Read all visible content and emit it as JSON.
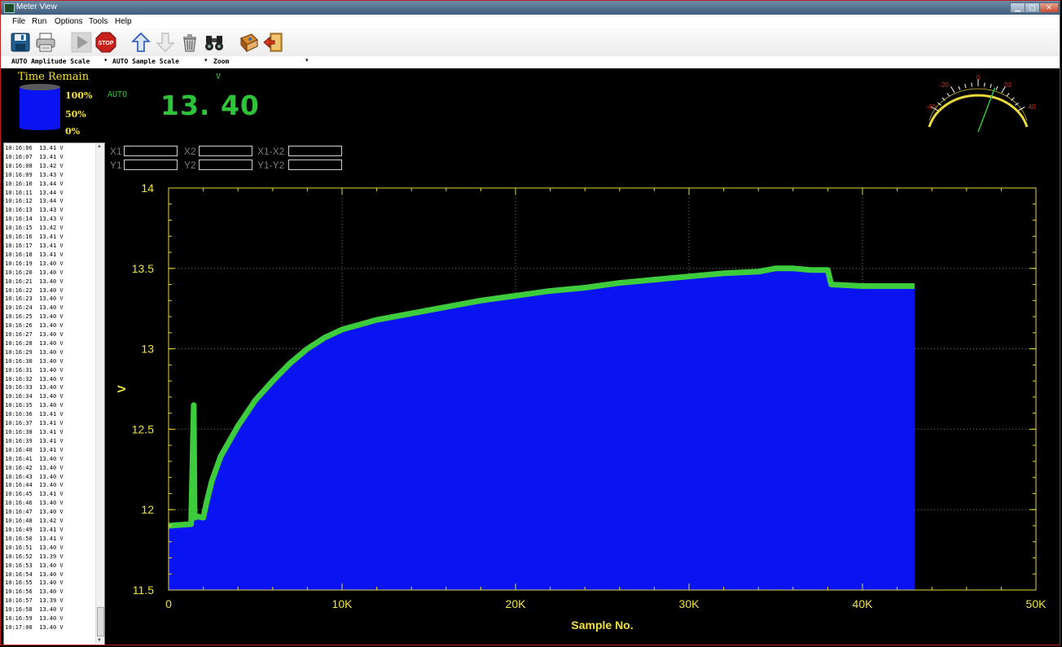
{
  "window": {
    "title": "Meter View",
    "min_glyph": "▁",
    "max_glyph": "▢",
    "close_glyph": "✕"
  },
  "menu": [
    "File",
    "Run",
    "Options",
    "Tools",
    "Help"
  ],
  "toolbar": {
    "buttons": [
      {
        "icon": "save-icon"
      },
      {
        "icon": "print-icon"
      },
      {
        "icon": "play-icon"
      },
      {
        "icon": "stop-icon",
        "label": "STOP"
      },
      {
        "icon": "arrow-up-icon"
      },
      {
        "icon": "arrow-down-icon"
      },
      {
        "icon": "trash-icon"
      },
      {
        "icon": "binoculars-icon"
      },
      {
        "icon": "book-icon"
      },
      {
        "icon": "exit-icon"
      }
    ]
  },
  "scales": {
    "amplitude": "AUTO Amplitude Scale",
    "sample": "AUTO Sample Scale",
    "zoom": "Zoom",
    "arrow": "▾"
  },
  "meter": {
    "time_remain_label": "Time Remain",
    "levels": [
      "100%",
      "50%",
      "0%"
    ],
    "mode": "AUTO",
    "unit": "V",
    "reading": "13. 40",
    "gauge_ticks": [
      "-40",
      "-20",
      "0",
      "20",
      "40"
    ],
    "gauge_needle_value": 13.4
  },
  "cursors": {
    "x1": "X1",
    "x2": "X2",
    "dx": "X1-X2",
    "y1": "Y1",
    "y2": "Y2",
    "dy": "Y1-Y2"
  },
  "log": [
    "10:16:06  13.41 V",
    "10:16:07  13.41 V",
    "10:16:08  13.42 V",
    "10:16:09  13.43 V",
    "10:16:10  13.44 V",
    "10:16:11  13.44 V",
    "10:16:12  13.44 V",
    "10:16:13  13.43 V",
    "10:16:14  13.43 V",
    "10:16:15  13.42 V",
    "10:16:16  13.41 V",
    "10:16:17  13.41 V",
    "10:16:18  13.41 V",
    "10:16:19  13.40 V",
    "10:16:20  13.40 V",
    "10:16:21  13.40 V",
    "10:16:22  13.40 V",
    "10:16:23  13.40 V",
    "10:16:24  13.40 V",
    "10:16:25  13.40 V",
    "10:16:26  13.40 V",
    "10:16:27  13.40 V",
    "10:16:28  13.40 V",
    "10:16:29  13.40 V",
    "10:16:30  13.40 V",
    "10:16:31  13.40 V",
    "10:16:32  13.40 V",
    "10:16:33  13.40 V",
    "10:16:34  13.40 V",
    "10:16:35  13.40 V",
    "10:16:36  13.41 V",
    "10:16:37  13.41 V",
    "10:16:38  13.41 V",
    "10:16:39  13.41 V",
    "10:16:40  13.41 V",
    "10:16:41  13.40 V",
    "10:16:42  13.40 V",
    "10:16:43  13.40 V",
    "10:16:44  13.40 V",
    "10:16:45  13.41 V",
    "10:16:46  13.40 V",
    "10:16:47  13.40 V",
    "10:16:48  13.42 V",
    "10:16:49  13.41 V",
    "10:16:50  13.41 V",
    "10:16:51  13.40 V",
    "10:16:52  13.39 V",
    "10:16:53  13.40 V",
    "10:16:54  13.40 V",
    "10:16:55  13.40 V",
    "10:16:56  13.40 V",
    "10:16:57  13.39 V",
    "10:16:58  13.40 V",
    "10:16:59  13.40 V",
    "10:17:00  13.40 V"
  ],
  "chart_data": {
    "type": "area",
    "xlabel": "Sample No.",
    "ylabel": "V",
    "xlim": [
      0,
      50000
    ],
    "ylim": [
      11.5,
      14
    ],
    "x_ticks": [
      "0",
      "10K",
      "20K",
      "30K",
      "40K",
      "50K"
    ],
    "y_ticks": [
      "11.5",
      "12",
      "12.5",
      "13",
      "13.5",
      "14"
    ],
    "grid": true,
    "series": [
      {
        "x": [
          0,
          1300,
          1450,
          1500,
          1550,
          2000,
          2200,
          2500,
          3000,
          4000,
          5000,
          6000,
          7000,
          8000,
          9000,
          10000,
          11000,
          12000,
          14000,
          16000,
          18000,
          20000,
          22000,
          24000,
          26000,
          28000,
          30000,
          32000,
          34000,
          35000,
          36000,
          37000,
          38000,
          38200,
          40000,
          42000,
          43000
        ],
        "y": [
          11.9,
          11.91,
          12.65,
          11.95,
          11.96,
          11.95,
          12.05,
          12.18,
          12.33,
          12.52,
          12.68,
          12.8,
          12.91,
          13.0,
          13.07,
          13.12,
          13.15,
          13.18,
          13.22,
          13.26,
          13.3,
          13.33,
          13.36,
          13.38,
          13.41,
          13.43,
          13.45,
          13.47,
          13.48,
          13.5,
          13.5,
          13.49,
          13.49,
          13.4,
          13.39,
          13.39,
          13.39
        ]
      }
    ],
    "colors": {
      "fill": "#0a14f2",
      "line": "#3ccc3c",
      "axis": "#e9d63a",
      "label": "#f0e23a"
    }
  }
}
